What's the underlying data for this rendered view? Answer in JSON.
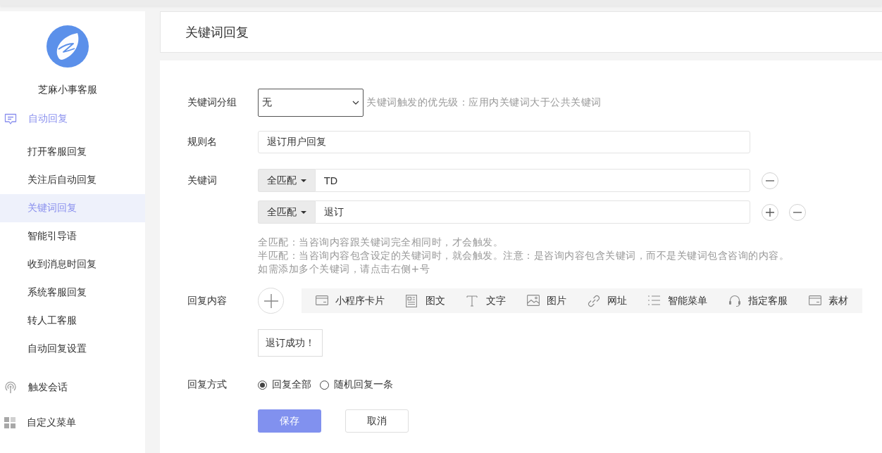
{
  "sidebar": {
    "brand": "芝麻小事客服",
    "menu": [
      {
        "label": "自动回复",
        "selected": true,
        "children": [
          {
            "label": "打开客服回复",
            "selected": false
          },
          {
            "label": "关注后自动回复",
            "selected": false
          },
          {
            "label": "关键词回复",
            "selected": true
          },
          {
            "label": "智能引导语",
            "selected": false
          },
          {
            "label": "收到消息时回复",
            "selected": false
          },
          {
            "label": "系统客服回复",
            "selected": false
          },
          {
            "label": "转人工客服",
            "selected": false
          },
          {
            "label": "自动回复设置",
            "selected": false
          }
        ]
      },
      {
        "label": "触发会话",
        "selected": false
      },
      {
        "label": "自定义菜单",
        "selected": false
      }
    ]
  },
  "header": {
    "title": "关键词回复"
  },
  "form": {
    "keyword_group": {
      "label": "关键词分组",
      "value": "无",
      "hint": "关键词触发的优先级：应用内关键词大于公共关键词"
    },
    "rule_name": {
      "label": "规则名",
      "value": "退订用户回复"
    },
    "keywords": {
      "label": "关键词",
      "items": [
        {
          "match": "全匹配",
          "value": "TD",
          "add_button": false
        },
        {
          "match": "全匹配",
          "value": "退订",
          "add_button": true
        }
      ],
      "help": [
        "全匹配：当咨询内容跟关键词完全相同时，才会触发。",
        "半匹配：当咨询内容包含设定的关键词时，就会触发。注意：是咨询内容包含关键词，而不是关键词包含咨询的内容。",
        "如需添加多个关键词，请点击右侧+号"
      ]
    },
    "reply_content": {
      "label": "回复内容",
      "toolbar": [
        {
          "label": "小程序卡片"
        },
        {
          "label": "图文"
        },
        {
          "label": "文字"
        },
        {
          "label": "图片"
        },
        {
          "label": "网址"
        },
        {
          "label": "智能菜单"
        },
        {
          "label": "指定客服"
        },
        {
          "label": "素材"
        }
      ],
      "messages": [
        "退订成功！"
      ]
    },
    "reply_mode": {
      "label": "回复方式",
      "options": [
        {
          "label": "回复全部",
          "selected": true
        },
        {
          "label": "随机回复一条",
          "selected": false
        }
      ]
    },
    "buttons": [
      {
        "label": "保存",
        "kind": "primary"
      },
      {
        "label": "取消",
        "kind": "secondary"
      }
    ]
  }
}
